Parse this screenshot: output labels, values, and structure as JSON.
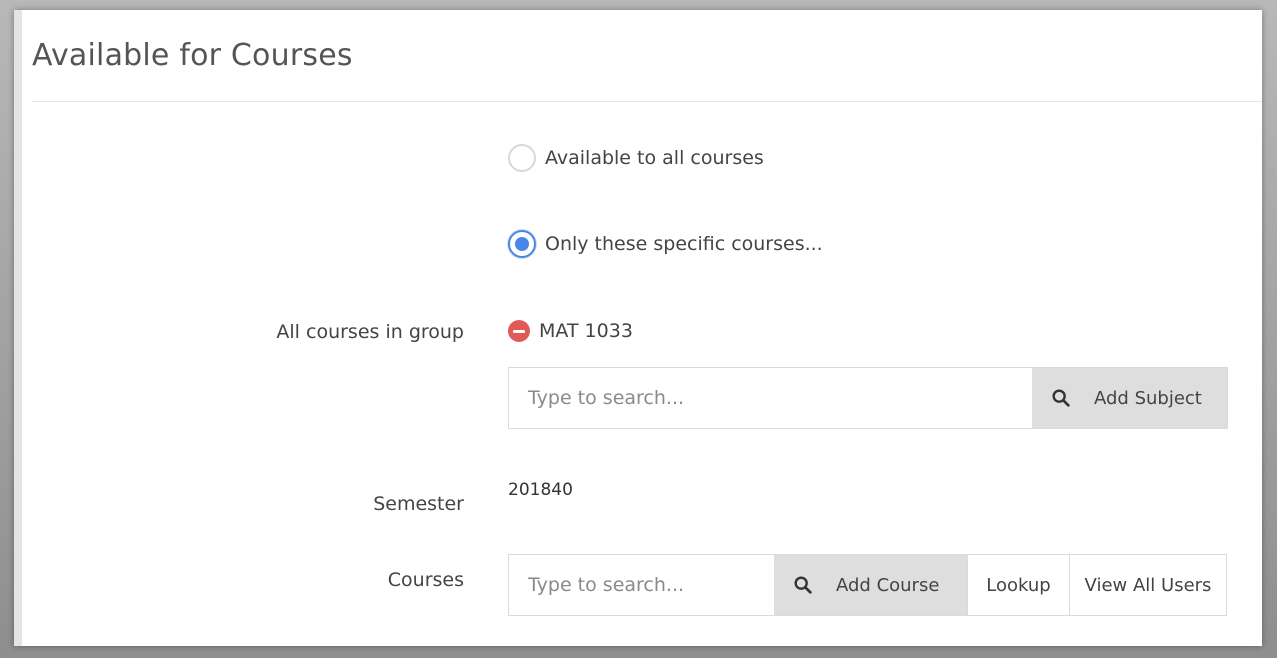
{
  "page": {
    "title": "Available for Courses"
  },
  "availability": {
    "options": [
      {
        "label": "Available to all courses",
        "checked": false
      },
      {
        "label": "Only these specific courses...",
        "checked": true
      }
    ]
  },
  "group": {
    "label": "All courses in group",
    "selected": [
      "MAT 1033"
    ],
    "search_placeholder": "Type to search...",
    "search_value": "",
    "add_button": "Add Subject"
  },
  "semester": {
    "label": "Semester",
    "value": "201840"
  },
  "courses": {
    "label": "Courses",
    "search_placeholder": "Type to search...",
    "search_value": "",
    "add_button": "Add Course",
    "lookup_button": "Lookup",
    "view_all_button": "View All Users"
  },
  "icons": {
    "search": "search-icon",
    "remove": "remove-circle-icon"
  },
  "colors": {
    "accent": "#4a86e8",
    "danger": "#e05a57",
    "button_grey": "#dedede"
  }
}
